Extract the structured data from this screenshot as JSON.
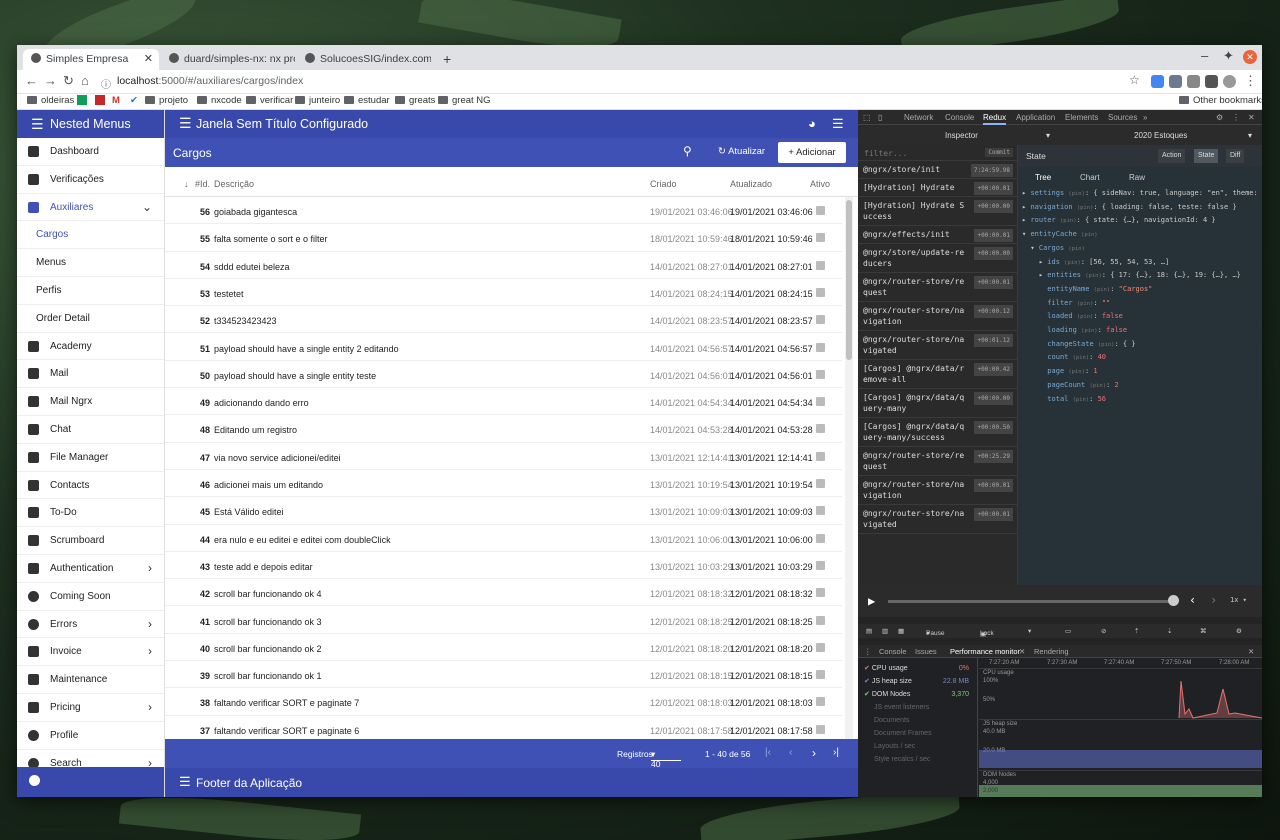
{
  "browser": {
    "tabs": [
      {
        "label": "Simples Empresa"
      },
      {
        "label": "duard/simples-nx: nx project"
      },
      {
        "label": "SolucoesSIG/index.compone"
      }
    ],
    "new_tab": "+",
    "url_host": "localhost",
    "url_path": ":5000/#/auxiliares/cargos/index",
    "bookmarks": [
      "oldeiras",
      "projeto",
      "nxcode",
      "verificar",
      "junteiro",
      "estudar",
      "greats",
      "great NG"
    ],
    "other_bookmarks": "Other bookmarks"
  },
  "sidebar": {
    "title": "Nested Menus",
    "items": [
      {
        "label": "Dashboard"
      },
      {
        "label": "Verificações"
      },
      {
        "label": "Auxiliares"
      },
      {
        "label": "Cargos"
      },
      {
        "label": "Menus"
      },
      {
        "label": "Perfis"
      },
      {
        "label": "Order Detail"
      },
      {
        "label": "Academy"
      },
      {
        "label": "Mail"
      },
      {
        "label": "Mail Ngrx"
      },
      {
        "label": "Chat"
      },
      {
        "label": "File Manager"
      },
      {
        "label": "Contacts"
      },
      {
        "label": "To-Do"
      },
      {
        "label": "Scrumboard"
      },
      {
        "label": "Authentication"
      },
      {
        "label": "Coming Soon"
      },
      {
        "label": "Errors"
      },
      {
        "label": "Invoice"
      },
      {
        "label": "Maintenance"
      },
      {
        "label": "Pricing"
      },
      {
        "label": "Profile"
      },
      {
        "label": "Search"
      }
    ]
  },
  "toolbar": {
    "title": "Janela Sem Título Configurado"
  },
  "page": {
    "title": "Cargos",
    "refresh_label": "Atualizar",
    "add_label": "Adicionar"
  },
  "table": {
    "columns": {
      "id": "#Id.",
      "description": "Descrição",
      "created": "Criado",
      "updated": "Atualizado",
      "active": "Ativo"
    },
    "rows": [
      {
        "id": "56",
        "desc": "goiabada gigantesca",
        "created": "19/01/2021 03:46:06",
        "updated": "19/01/2021 03:46:06"
      },
      {
        "id": "55",
        "desc": "falta somente o sort e o filter",
        "created": "18/01/2021 10:59:46",
        "updated": "18/01/2021 10:59:46"
      },
      {
        "id": "54",
        "desc": "sddd edutei beleza",
        "created": "14/01/2021 08:27:01",
        "updated": "14/01/2021 08:27:01"
      },
      {
        "id": "53",
        "desc": "testetet",
        "created": "14/01/2021 08:24:15",
        "updated": "14/01/2021 08:24:15"
      },
      {
        "id": "52",
        "desc": "t334523423423",
        "created": "14/01/2021 08:23:57",
        "updated": "14/01/2021 08:23:57"
      },
      {
        "id": "51",
        "desc": "payload should have a single entity 2 editando",
        "created": "14/01/2021 04:56:57",
        "updated": "14/01/2021 04:56:57"
      },
      {
        "id": "50",
        "desc": "payload should have a single entity teste",
        "created": "14/01/2021 04:56:01",
        "updated": "14/01/2021 04:56:01"
      },
      {
        "id": "49",
        "desc": "adicionando dando erro",
        "created": "14/01/2021 04:54:34",
        "updated": "14/01/2021 04:54:34"
      },
      {
        "id": "48",
        "desc": "Editando um registro",
        "created": "14/01/2021 04:53:28",
        "updated": "14/01/2021 04:53:28"
      },
      {
        "id": "47",
        "desc": "via novo service adicionei/editei",
        "created": "13/01/2021 12:14:41",
        "updated": "13/01/2021 12:14:41"
      },
      {
        "id": "46",
        "desc": "adicionei mais um editando",
        "created": "13/01/2021 10:19:54",
        "updated": "13/01/2021 10:19:54"
      },
      {
        "id": "45",
        "desc": "Está Válido editei",
        "created": "13/01/2021 10:09:03",
        "updated": "13/01/2021 10:09:03"
      },
      {
        "id": "44",
        "desc": "era nulo e eu editei e editei com doubleClick",
        "created": "13/01/2021 10:06:00",
        "updated": "13/01/2021 10:06:00"
      },
      {
        "id": "43",
        "desc": "teste add e depois editar",
        "created": "13/01/2021 10:03:29",
        "updated": "13/01/2021 10:03:29"
      },
      {
        "id": "42",
        "desc": "scroll bar funcionando ok 4",
        "created": "12/01/2021 08:18:32",
        "updated": "12/01/2021 08:18:32"
      },
      {
        "id": "41",
        "desc": "scroll bar funcionando ok 3",
        "created": "12/01/2021 08:18:25",
        "updated": "12/01/2021 08:18:25"
      },
      {
        "id": "40",
        "desc": "scroll bar funcionando ok 2",
        "created": "12/01/2021 08:18:20",
        "updated": "12/01/2021 08:18:20"
      },
      {
        "id": "39",
        "desc": "scroll bar funcionando ok 1",
        "created": "12/01/2021 08:18:15",
        "updated": "12/01/2021 08:18:15"
      },
      {
        "id": "38",
        "desc": "faltando verificar SORT e paginate 7",
        "created": "12/01/2021 08:18:03",
        "updated": "12/01/2021 08:18:03"
      },
      {
        "id": "37",
        "desc": "faltando verificar SORT e paginate 6",
        "created": "12/01/2021 08:17:58",
        "updated": "12/01/2021 08:17:58"
      }
    ]
  },
  "paginator": {
    "label": "Registros",
    "page_size": "40",
    "range": "1 - 40 de 56"
  },
  "footer": {
    "title": "Footer da Aplicação"
  },
  "devtools": {
    "tabs": [
      "Network",
      "Console",
      "Redux",
      "Application",
      "Elements",
      "Sources"
    ],
    "inspector": "Inspector",
    "instance": "2020 Estoques",
    "filter_placeholder": "filter...",
    "commit": "Commit",
    "actions": [
      {
        "name": "@ngrx/store/init",
        "time": "7:24:59.98"
      },
      {
        "name": "[Hydration] Hydrate",
        "time": "+00:00.01"
      },
      {
        "name": "[Hydration] Hydrate Success",
        "time": "+00:00.00"
      },
      {
        "name": "@ngrx/effects/init",
        "time": "+00:00.01"
      },
      {
        "name": "@ngrx/store/update-reducers",
        "time": "+00:00.00"
      },
      {
        "name": "@ngrx/router-store/request",
        "time": "+00:00.01"
      },
      {
        "name": "@ngrx/router-store/navigation",
        "time": "+00:00.12"
      },
      {
        "name": "@ngrx/router-store/navigated",
        "time": "+00:01.12"
      },
      {
        "name": "[Cargos] @ngrx/data/remove-all",
        "time": "+00:00.42"
      },
      {
        "name": "[Cargos] @ngrx/data/query-many",
        "time": "+00:00.00"
      },
      {
        "name": "[Cargos] @ngrx/data/query-many/success",
        "time": "+00:00.50"
      },
      {
        "name": "@ngrx/router-store/request",
        "time": "+00:25.29"
      },
      {
        "name": "@ngrx/router-store/navigation",
        "time": "+00:00.01"
      },
      {
        "name": "@ngrx/router-store/navigated",
        "time": "+00:00.01"
      }
    ],
    "state_label": "State",
    "state_buttons": [
      "Action",
      "State",
      "Diff"
    ],
    "state_tabs": [
      "Tree",
      "Chart",
      "Raw"
    ],
    "speed": "1x",
    "tools": [
      "Pause",
      "Lock"
    ],
    "drawer_tabs": [
      "Console",
      "Issues",
      "Performance monitor",
      "Rendering"
    ],
    "metrics": [
      {
        "label": "CPU usage",
        "value": "0%"
      },
      {
        "label": "JS heap size",
        "value": "22.8 MB"
      },
      {
        "label": "DOM Nodes",
        "value": "3,370"
      },
      {
        "label": "JS event listeners",
        "value": ""
      },
      {
        "label": "Documents",
        "value": ""
      },
      {
        "label": "Document Frames",
        "value": ""
      },
      {
        "label": "Layouts / sec",
        "value": ""
      },
      {
        "label": "Style recalcs / sec",
        "value": ""
      }
    ],
    "graph_times": [
      "7:27:20 AM",
      "7:27:30 AM",
      "7:27:40 AM",
      "7:27:50 AM",
      "7:28:00 AM"
    ],
    "graph_labels": {
      "cpu": "CPU usage",
      "cpu_100": "100%",
      "cpu_50": "50%",
      "heap": "JS heap size",
      "heap_40": "40.0 MB",
      "heap_20": "20.0 MB",
      "dom": "DOM Nodes",
      "dom_4000": "4,000",
      "dom_2000": "2,000"
    }
  },
  "colors": {
    "primary": "#3949ab",
    "accent": "#3f51b5"
  }
}
